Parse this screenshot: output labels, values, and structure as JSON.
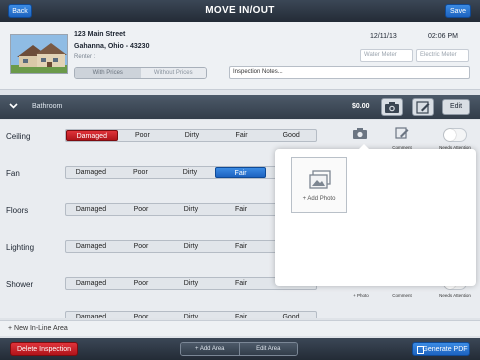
{
  "topbar": {
    "title": "MOVE IN/OUT",
    "back_label": "Back",
    "save_label": "Save"
  },
  "property": {
    "street": "123 Main Street",
    "city_line": "Gahanna, Ohio - 43230",
    "renter_label": "Renter :",
    "date": "12/11/13",
    "time": "02:06 PM",
    "water_meter_placeholder": "Water Meter",
    "electric_meter_placeholder": "Electric Meter",
    "price_toggle": [
      "With Prices",
      "Without Prices"
    ],
    "notes_placeholder": "Inspection Notes..."
  },
  "section": {
    "name": "Bathroom",
    "price": "$0.00",
    "edit_label": "Edit"
  },
  "rating_options": [
    "Damaged",
    "Poor",
    "Dirty",
    "Fair",
    "Good"
  ],
  "rows": [
    {
      "label": "Ceiling",
      "selected": "Damaged"
    },
    {
      "label": "Fan",
      "selected": "Fair"
    },
    {
      "label": "Floors",
      "selected": ""
    },
    {
      "label": "Lighting",
      "selected": ""
    },
    {
      "label": "Shower",
      "selected": ""
    }
  ],
  "row_captions": {
    "photo": "+ Photo",
    "comment": "Comment",
    "needs_attention": "Needs Attention"
  },
  "popup": {
    "add_photo_label": "+ Add Photo"
  },
  "inline_area_label": "+ New In-Line Area",
  "bottombar": {
    "delete_label": "Delete Inspection",
    "add_area_label": "+ Add Area",
    "edit_area_label": "Edit Area",
    "generate_pdf_label": "Generate PDF"
  },
  "colors": {
    "accent_blue": "#2472d0",
    "danger_red": "#c81e24",
    "bar_dark": "#2e3844"
  }
}
